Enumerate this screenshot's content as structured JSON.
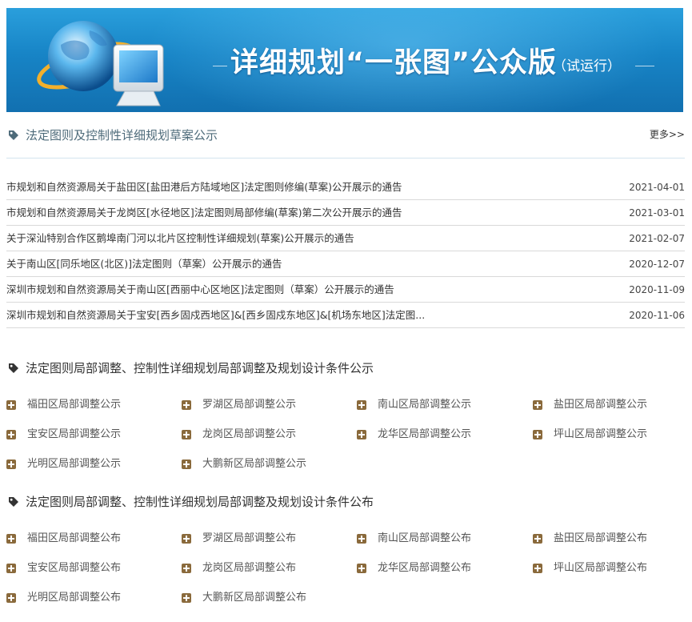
{
  "banner": {
    "title": "详细规划“一张图”公众版",
    "subtitle": "（试运行）"
  },
  "section1": {
    "title": "法定图则及控制性详细规划草案公示",
    "more_label": "更多>>",
    "notices": [
      {
        "text": "市规划和自然资源局关于盐田区[盐田港后方陆域地区]法定图则修编(草案)公开展示的通告",
        "date": "2021-04-01"
      },
      {
        "text": "市规划和自然资源局关于龙岗区[水径地区]法定图则局部修编(草案)第二次公开展示的通告",
        "date": "2021-03-01"
      },
      {
        "text": "关于深汕特别合作区鹅埠南门河以北片区控制性详细规划(草案)公开展示的通告",
        "date": "2021-02-07"
      },
      {
        "text": "关于南山区[同乐地区(北区)]法定图则（草案）公开展示的通告",
        "date": "2020-12-07"
      },
      {
        "text": "深圳市规划和自然资源局关于南山区[西丽中心区地区]法定图则（草案）公开展示的通告",
        "date": "2020-11-09"
      },
      {
        "text": "深圳市规划和自然资源局关于宝安[西乡固戍西地区]&[西乡固戍东地区]&[机场东地区]法定图...",
        "date": "2020-11-06"
      }
    ]
  },
  "section2": {
    "title": "法定图则局部调整、控制性详细规划局部调整及规划设计条件公示",
    "items": [
      "福田区局部调整公示",
      "罗湖区局部调整公示",
      "南山区局部调整公示",
      "盐田区局部调整公示",
      "宝安区局部调整公示",
      "龙岗区局部调整公示",
      "龙华区局部调整公示",
      "坪山区局部调整公示",
      "光明区局部调整公示",
      "大鹏新区局部调整公示"
    ]
  },
  "section3": {
    "title": "法定图则局部调整、控制性详细规划局部调整及规划设计条件公布",
    "items": [
      "福田区局部调整公布",
      "罗湖区局部调整公布",
      "南山区局部调整公布",
      "盐田区局部调整公布",
      "宝安区局部调整公布",
      "龙岗区局部调整公布",
      "龙华区局部调整公布",
      "坪山区局部调整公布",
      "光明区局部调整公布",
      "大鹏新区局部调整公布"
    ]
  },
  "icons": {
    "section_tag": "tag-icon",
    "list_bullet": "plus-square-icon"
  },
  "colors": {
    "banner_blue": "#1784c6",
    "section1_title": "#4e6b7a",
    "bullet_brown": "#8a6a3c"
  }
}
